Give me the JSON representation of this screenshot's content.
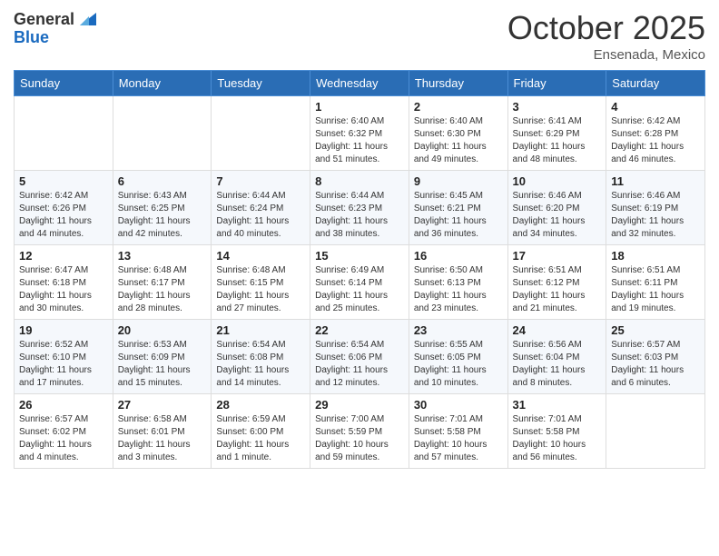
{
  "header": {
    "logo_general": "General",
    "logo_blue": "Blue",
    "month": "October 2025",
    "location": "Ensenada, Mexico"
  },
  "weekdays": [
    "Sunday",
    "Monday",
    "Tuesday",
    "Wednesday",
    "Thursday",
    "Friday",
    "Saturday"
  ],
  "weeks": [
    [
      {
        "day": "",
        "info": ""
      },
      {
        "day": "",
        "info": ""
      },
      {
        "day": "",
        "info": ""
      },
      {
        "day": "1",
        "info": "Sunrise: 6:40 AM\nSunset: 6:32 PM\nDaylight: 11 hours\nand 51 minutes."
      },
      {
        "day": "2",
        "info": "Sunrise: 6:40 AM\nSunset: 6:30 PM\nDaylight: 11 hours\nand 49 minutes."
      },
      {
        "day": "3",
        "info": "Sunrise: 6:41 AM\nSunset: 6:29 PM\nDaylight: 11 hours\nand 48 minutes."
      },
      {
        "day": "4",
        "info": "Sunrise: 6:42 AM\nSunset: 6:28 PM\nDaylight: 11 hours\nand 46 minutes."
      }
    ],
    [
      {
        "day": "5",
        "info": "Sunrise: 6:42 AM\nSunset: 6:26 PM\nDaylight: 11 hours\nand 44 minutes."
      },
      {
        "day": "6",
        "info": "Sunrise: 6:43 AM\nSunset: 6:25 PM\nDaylight: 11 hours\nand 42 minutes."
      },
      {
        "day": "7",
        "info": "Sunrise: 6:44 AM\nSunset: 6:24 PM\nDaylight: 11 hours\nand 40 minutes."
      },
      {
        "day": "8",
        "info": "Sunrise: 6:44 AM\nSunset: 6:23 PM\nDaylight: 11 hours\nand 38 minutes."
      },
      {
        "day": "9",
        "info": "Sunrise: 6:45 AM\nSunset: 6:21 PM\nDaylight: 11 hours\nand 36 minutes."
      },
      {
        "day": "10",
        "info": "Sunrise: 6:46 AM\nSunset: 6:20 PM\nDaylight: 11 hours\nand 34 minutes."
      },
      {
        "day": "11",
        "info": "Sunrise: 6:46 AM\nSunset: 6:19 PM\nDaylight: 11 hours\nand 32 minutes."
      }
    ],
    [
      {
        "day": "12",
        "info": "Sunrise: 6:47 AM\nSunset: 6:18 PM\nDaylight: 11 hours\nand 30 minutes."
      },
      {
        "day": "13",
        "info": "Sunrise: 6:48 AM\nSunset: 6:17 PM\nDaylight: 11 hours\nand 28 minutes."
      },
      {
        "day": "14",
        "info": "Sunrise: 6:48 AM\nSunset: 6:15 PM\nDaylight: 11 hours\nand 27 minutes."
      },
      {
        "day": "15",
        "info": "Sunrise: 6:49 AM\nSunset: 6:14 PM\nDaylight: 11 hours\nand 25 minutes."
      },
      {
        "day": "16",
        "info": "Sunrise: 6:50 AM\nSunset: 6:13 PM\nDaylight: 11 hours\nand 23 minutes."
      },
      {
        "day": "17",
        "info": "Sunrise: 6:51 AM\nSunset: 6:12 PM\nDaylight: 11 hours\nand 21 minutes."
      },
      {
        "day": "18",
        "info": "Sunrise: 6:51 AM\nSunset: 6:11 PM\nDaylight: 11 hours\nand 19 minutes."
      }
    ],
    [
      {
        "day": "19",
        "info": "Sunrise: 6:52 AM\nSunset: 6:10 PM\nDaylight: 11 hours\nand 17 minutes."
      },
      {
        "day": "20",
        "info": "Sunrise: 6:53 AM\nSunset: 6:09 PM\nDaylight: 11 hours\nand 15 minutes."
      },
      {
        "day": "21",
        "info": "Sunrise: 6:54 AM\nSunset: 6:08 PM\nDaylight: 11 hours\nand 14 minutes."
      },
      {
        "day": "22",
        "info": "Sunrise: 6:54 AM\nSunset: 6:06 PM\nDaylight: 11 hours\nand 12 minutes."
      },
      {
        "day": "23",
        "info": "Sunrise: 6:55 AM\nSunset: 6:05 PM\nDaylight: 11 hours\nand 10 minutes."
      },
      {
        "day": "24",
        "info": "Sunrise: 6:56 AM\nSunset: 6:04 PM\nDaylight: 11 hours\nand 8 minutes."
      },
      {
        "day": "25",
        "info": "Sunrise: 6:57 AM\nSunset: 6:03 PM\nDaylight: 11 hours\nand 6 minutes."
      }
    ],
    [
      {
        "day": "26",
        "info": "Sunrise: 6:57 AM\nSunset: 6:02 PM\nDaylight: 11 hours\nand 4 minutes."
      },
      {
        "day": "27",
        "info": "Sunrise: 6:58 AM\nSunset: 6:01 PM\nDaylight: 11 hours\nand 3 minutes."
      },
      {
        "day": "28",
        "info": "Sunrise: 6:59 AM\nSunset: 6:00 PM\nDaylight: 11 hours\nand 1 minute."
      },
      {
        "day": "29",
        "info": "Sunrise: 7:00 AM\nSunset: 5:59 PM\nDaylight: 10 hours\nand 59 minutes."
      },
      {
        "day": "30",
        "info": "Sunrise: 7:01 AM\nSunset: 5:58 PM\nDaylight: 10 hours\nand 57 minutes."
      },
      {
        "day": "31",
        "info": "Sunrise: 7:01 AM\nSunset: 5:58 PM\nDaylight: 10 hours\nand 56 minutes."
      },
      {
        "day": "",
        "info": ""
      }
    ]
  ]
}
